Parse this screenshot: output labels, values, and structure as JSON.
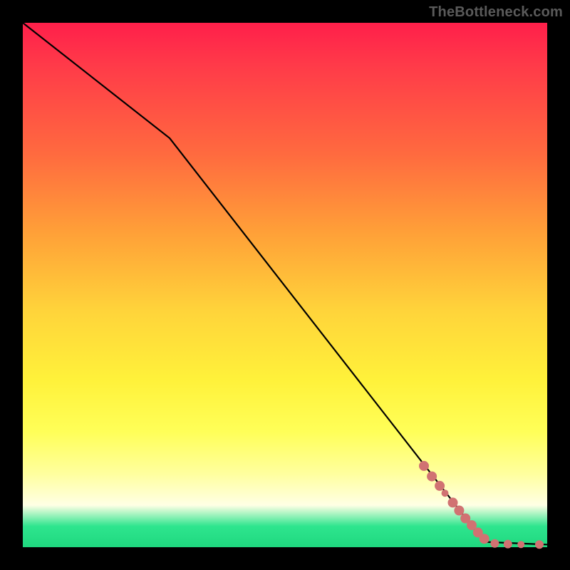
{
  "watermark": "TheBottleneck.com",
  "chart_data": {
    "type": "line",
    "xlim": [
      0,
      100
    ],
    "ylim": [
      0,
      100
    ],
    "title": "",
    "xlabel": "",
    "ylabel": "",
    "grid": false,
    "line": [
      {
        "x": 0,
        "y": 100
      },
      {
        "x": 28,
        "y": 78
      },
      {
        "x": 88,
        "y": 1
      },
      {
        "x": 100,
        "y": 0.5
      }
    ],
    "markers": [
      {
        "x": 76.5,
        "y": 15.5,
        "r": 7
      },
      {
        "x": 78.0,
        "y": 13.5,
        "r": 7
      },
      {
        "x": 79.5,
        "y": 11.7,
        "r": 7
      },
      {
        "x": 80.5,
        "y": 10.3,
        "r": 5
      },
      {
        "x": 82.0,
        "y": 8.5,
        "r": 7
      },
      {
        "x": 83.2,
        "y": 7.0,
        "r": 7
      },
      {
        "x": 84.4,
        "y": 5.5,
        "r": 7
      },
      {
        "x": 85.6,
        "y": 4.2,
        "r": 7
      },
      {
        "x": 86.8,
        "y": 2.8,
        "r": 7
      },
      {
        "x": 88.0,
        "y": 1.6,
        "r": 7
      },
      {
        "x": 90.0,
        "y": 0.7,
        "r": 6
      },
      {
        "x": 92.5,
        "y": 0.6,
        "r": 6
      },
      {
        "x": 95.0,
        "y": 0.5,
        "r": 5
      },
      {
        "x": 98.5,
        "y": 0.5,
        "r": 6
      }
    ],
    "marker_color": "#d17272",
    "line_color": "#000000"
  }
}
